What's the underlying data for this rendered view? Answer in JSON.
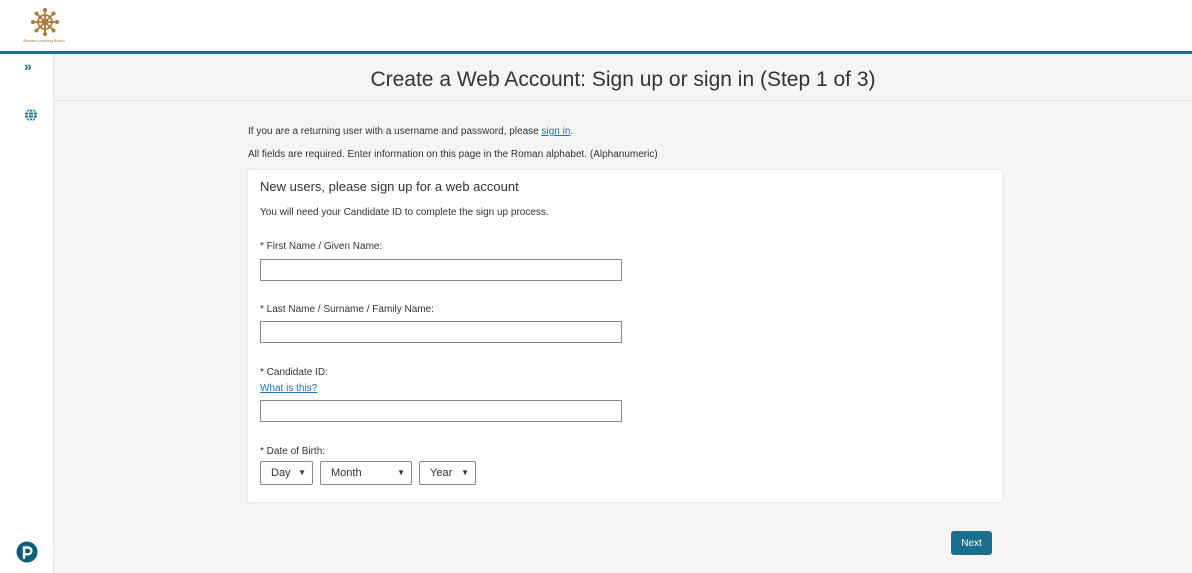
{
  "header": {
    "logo_text": "Bhutan Learning Board"
  },
  "sidebar": {
    "expand_glyph": "»"
  },
  "page": {
    "title": "Create a Web Account: Sign up or sign in (Step 1 of 3)"
  },
  "intro": {
    "returning_prefix": "If you are a returning user with a username and password, please ",
    "sign_in_link": "sign in",
    "returning_suffix": ".",
    "requirements": "All fields are required. Enter information on this page in the Roman alphabet. (Alphanumeric)"
  },
  "form": {
    "heading": "New users, please sign up for a web account",
    "note": "You will need your Candidate ID to complete the sign up process.",
    "first_name_label": "* First Name / Given Name:",
    "first_name_value": "",
    "last_name_label": "* Last Name / Surname / Family Name:",
    "last_name_value": "",
    "candidate_id_label": "* Candidate ID:",
    "candidate_id_help": "What is this?",
    "candidate_id_value": "",
    "dob_label": "* Date of Birth:",
    "dob_day": "Day",
    "dob_month": "Month",
    "dob_year": "Year"
  },
  "actions": {
    "next_label": "Next"
  },
  "colors": {
    "primary": "#1a6e8e",
    "link": "#1a73b8",
    "background": "#f5f5f5"
  },
  "icons": {
    "expand": "chevron-double-right-icon",
    "language": "globe-icon",
    "brand": "pearson-logo-icon",
    "dropdown": "caret-down-icon"
  }
}
